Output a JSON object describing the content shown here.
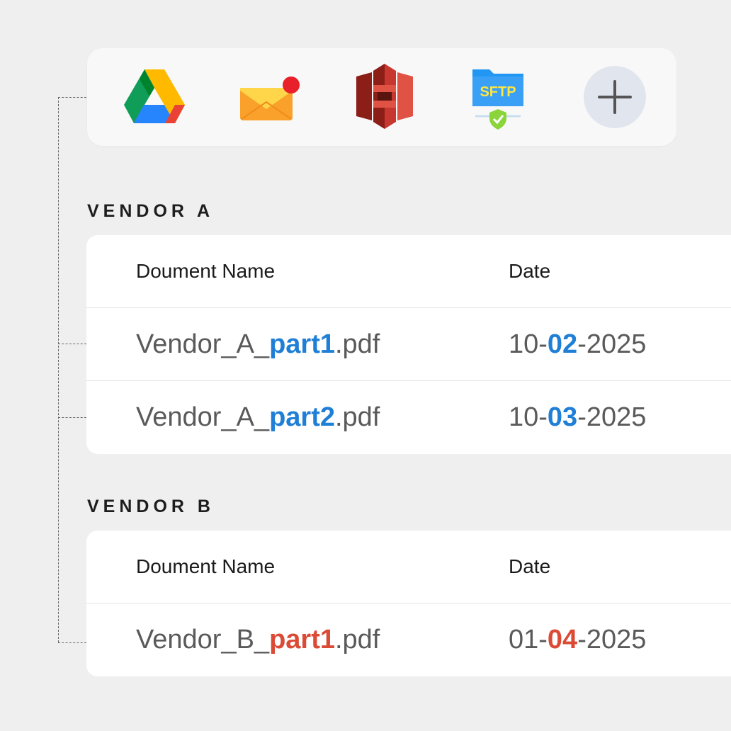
{
  "integrations": [
    {
      "name": "Google Drive",
      "icon": "google-drive-icon"
    },
    {
      "name": "Email",
      "icon": "envelope-notification-icon",
      "badge_color": "#e8202a"
    },
    {
      "name": "Amazon S3",
      "icon": "amazon-s3-icon"
    },
    {
      "name": "SFTP",
      "icon": "sftp-folder-icon",
      "label": "SFTP"
    },
    {
      "name": "Add",
      "icon": "plus-icon"
    }
  ],
  "vendors": [
    {
      "title": "VENDOR A",
      "accent": "#1f7fd6",
      "headers": {
        "name": "Doument Name",
        "date": "Date"
      },
      "rows": [
        {
          "name_prefix": "Vendor_A_",
          "name_highlight": "part1",
          "name_suffix": ".pdf",
          "date_prefix": "10-",
          "date_highlight": "02",
          "date_suffix": "-2025"
        },
        {
          "name_prefix": "Vendor_A_",
          "name_highlight": "part2",
          "name_suffix": ".pdf",
          "date_prefix": "10-",
          "date_highlight": "03",
          "date_suffix": "-2025"
        }
      ]
    },
    {
      "title": "VENDOR B",
      "accent": "#db4a35",
      "headers": {
        "name": "Doument Name",
        "date": "Date"
      },
      "rows": [
        {
          "name_prefix": "Vendor_B_",
          "name_highlight": "part1",
          "name_suffix": ".pdf",
          "date_prefix": "01-",
          "date_highlight": "04",
          "date_suffix": "-2025"
        }
      ]
    }
  ]
}
